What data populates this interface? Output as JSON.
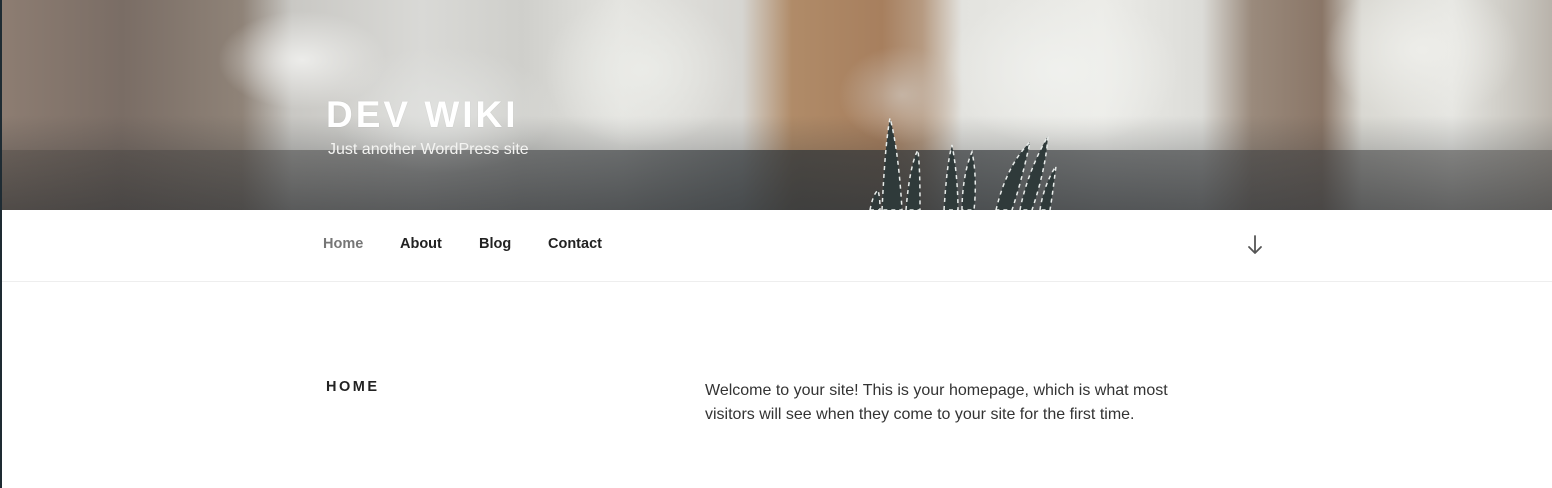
{
  "site": {
    "title": "DEV WIKI",
    "tagline": "Just another WordPress site"
  },
  "nav": {
    "items": [
      {
        "label": "Home",
        "current": true
      },
      {
        "label": "About",
        "current": false
      },
      {
        "label": "Blog",
        "current": false
      },
      {
        "label": "Contact",
        "current": false
      }
    ],
    "scroll_icon": "arrow-down-icon"
  },
  "content": {
    "heading": "HOME",
    "body": "Welcome to your site! This is your homepage, which is what most visitors will see when they come to your site for the first time."
  },
  "colors": {
    "text_dark": "#222222",
    "nav_current": "#767676",
    "body_text": "#333333",
    "header_text": "#ffffff"
  }
}
